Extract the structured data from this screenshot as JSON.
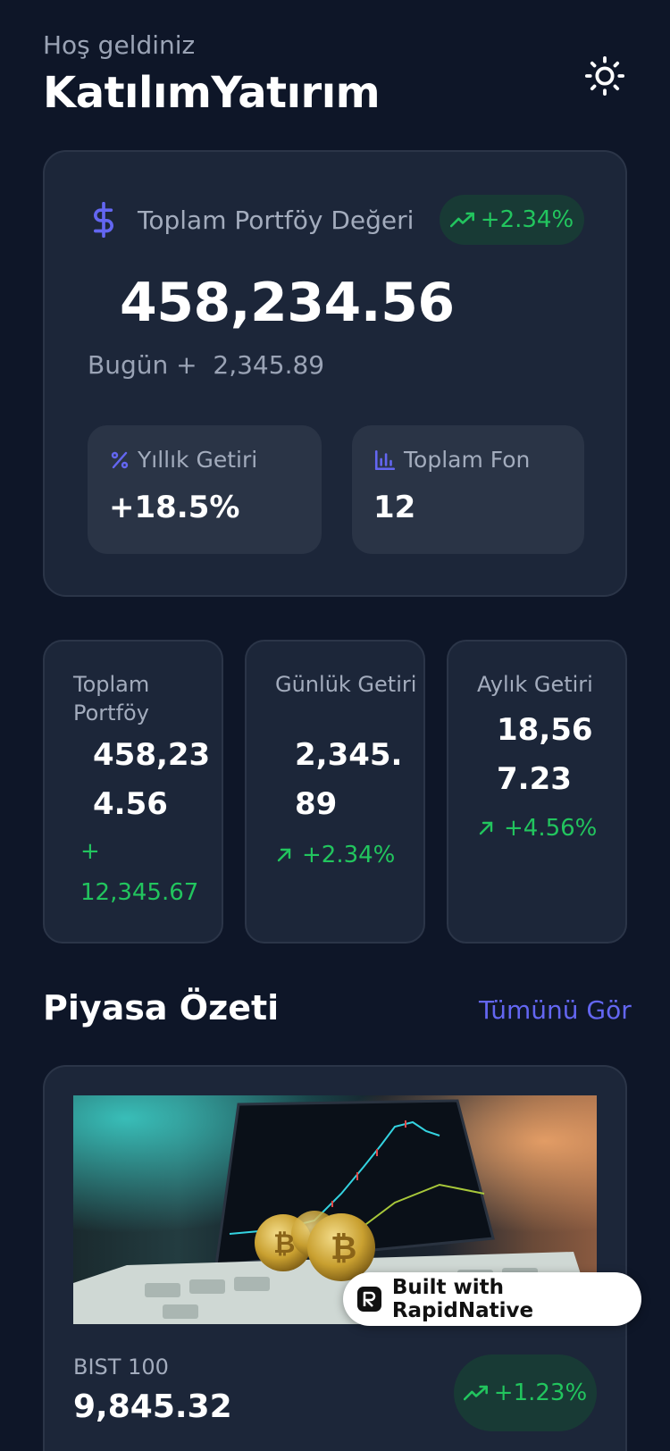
{
  "header": {
    "greeting": "Hoş geldiniz",
    "title": "KatılımYatırım",
    "theme_icon": "sun-icon"
  },
  "portfolio": {
    "label": "Toplam Portföy Değeri",
    "icon": "dollar-icon",
    "change_badge": "+2.34%",
    "value": "458,234.56",
    "today_label": "Bugün +",
    "today_value": "2,345.89",
    "annual": {
      "label": "Yıllık Getiri",
      "icon": "percent-icon",
      "value": "+18.5%"
    },
    "funds": {
      "label": "Toplam Fon",
      "icon": "bar-chart-icon",
      "value": "12"
    }
  },
  "stats": [
    {
      "label": "Toplam Portföy",
      "value": "458,234.56",
      "change": "+ 12,345.67"
    },
    {
      "label": "Günlük Getiri",
      "value": "2,345.89",
      "change": "+2.34%"
    },
    {
      "label": "Aylık Getiri",
      "value": "18,567.23",
      "change": "+4.56%"
    }
  ],
  "market": {
    "section_title": "Piyasa Özeti",
    "see_all": "Tümünü Gör",
    "card": {
      "name": "BIST 100",
      "value": "9,845.32",
      "change": "+1.23%"
    }
  },
  "built_with": "Built with RapidNative",
  "colors": {
    "background": "#0e1628",
    "card": "#1c2639",
    "accent": "#6366f1",
    "positive": "#22c55e"
  }
}
